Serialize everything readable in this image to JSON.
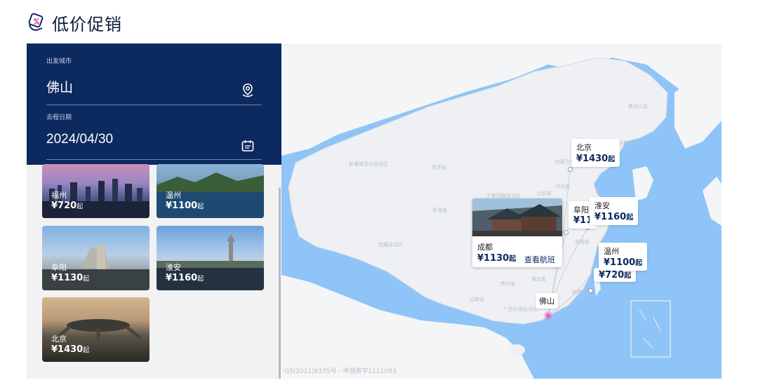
{
  "page": {
    "title": "低价促销",
    "icon": "promo-tag-icon"
  },
  "search": {
    "departure_label": "出发城市",
    "departure_value": "佛山",
    "departure_icon": "location-pin-icon",
    "date_label": "去程日期",
    "date_value": "2024/04/30",
    "date_icon": "calendar-icon",
    "background": "#0d2a60"
  },
  "cards": [
    {
      "city": "福州",
      "price": "¥720",
      "suffix": "起"
    },
    {
      "city": "温州",
      "price": "¥1100",
      "suffix": "起"
    },
    {
      "city": "阜阳",
      "price": "¥1130",
      "suffix": "起"
    },
    {
      "city": "淮安",
      "price": "¥1160",
      "suffix": "起"
    },
    {
      "city": "北京",
      "price": "¥1430",
      "suffix": "起"
    }
  ],
  "map": {
    "watermark": "GS(2021)6375号 - 甲测资字1111093",
    "origin": "佛山",
    "popup": {
      "city": "成都",
      "price": "¥1130",
      "suffix": "起",
      "link": "查看航班"
    },
    "bubbles": [
      {
        "city": "北京",
        "price": "¥1430",
        "suffix": "起"
      },
      {
        "city": "阜阳",
        "price": "¥11",
        "suffix": ""
      },
      {
        "city": "淮安",
        "price": "¥1160",
        "suffix": "起"
      },
      {
        "city": "温州",
        "price": "¥1100",
        "suffix": "起"
      },
      {
        "city": "福州",
        "price": "¥720",
        "suffix": "起"
      }
    ],
    "provinces": [
      "黑龙江省",
      "吉林省",
      "新疆维吾尔自治区",
      "内蒙古自治区",
      "甘肃省",
      "宁夏回族自治区",
      "山西省",
      "青海省",
      "河北省",
      "西藏自治区",
      "安徽省",
      "湖北省",
      "贵州省",
      "云南省",
      "广西壮族自治区",
      "福建省"
    ],
    "colors": {
      "sea": "#8ec4f7",
      "land": "#eef0f4",
      "accent": "#e26cc1"
    }
  }
}
